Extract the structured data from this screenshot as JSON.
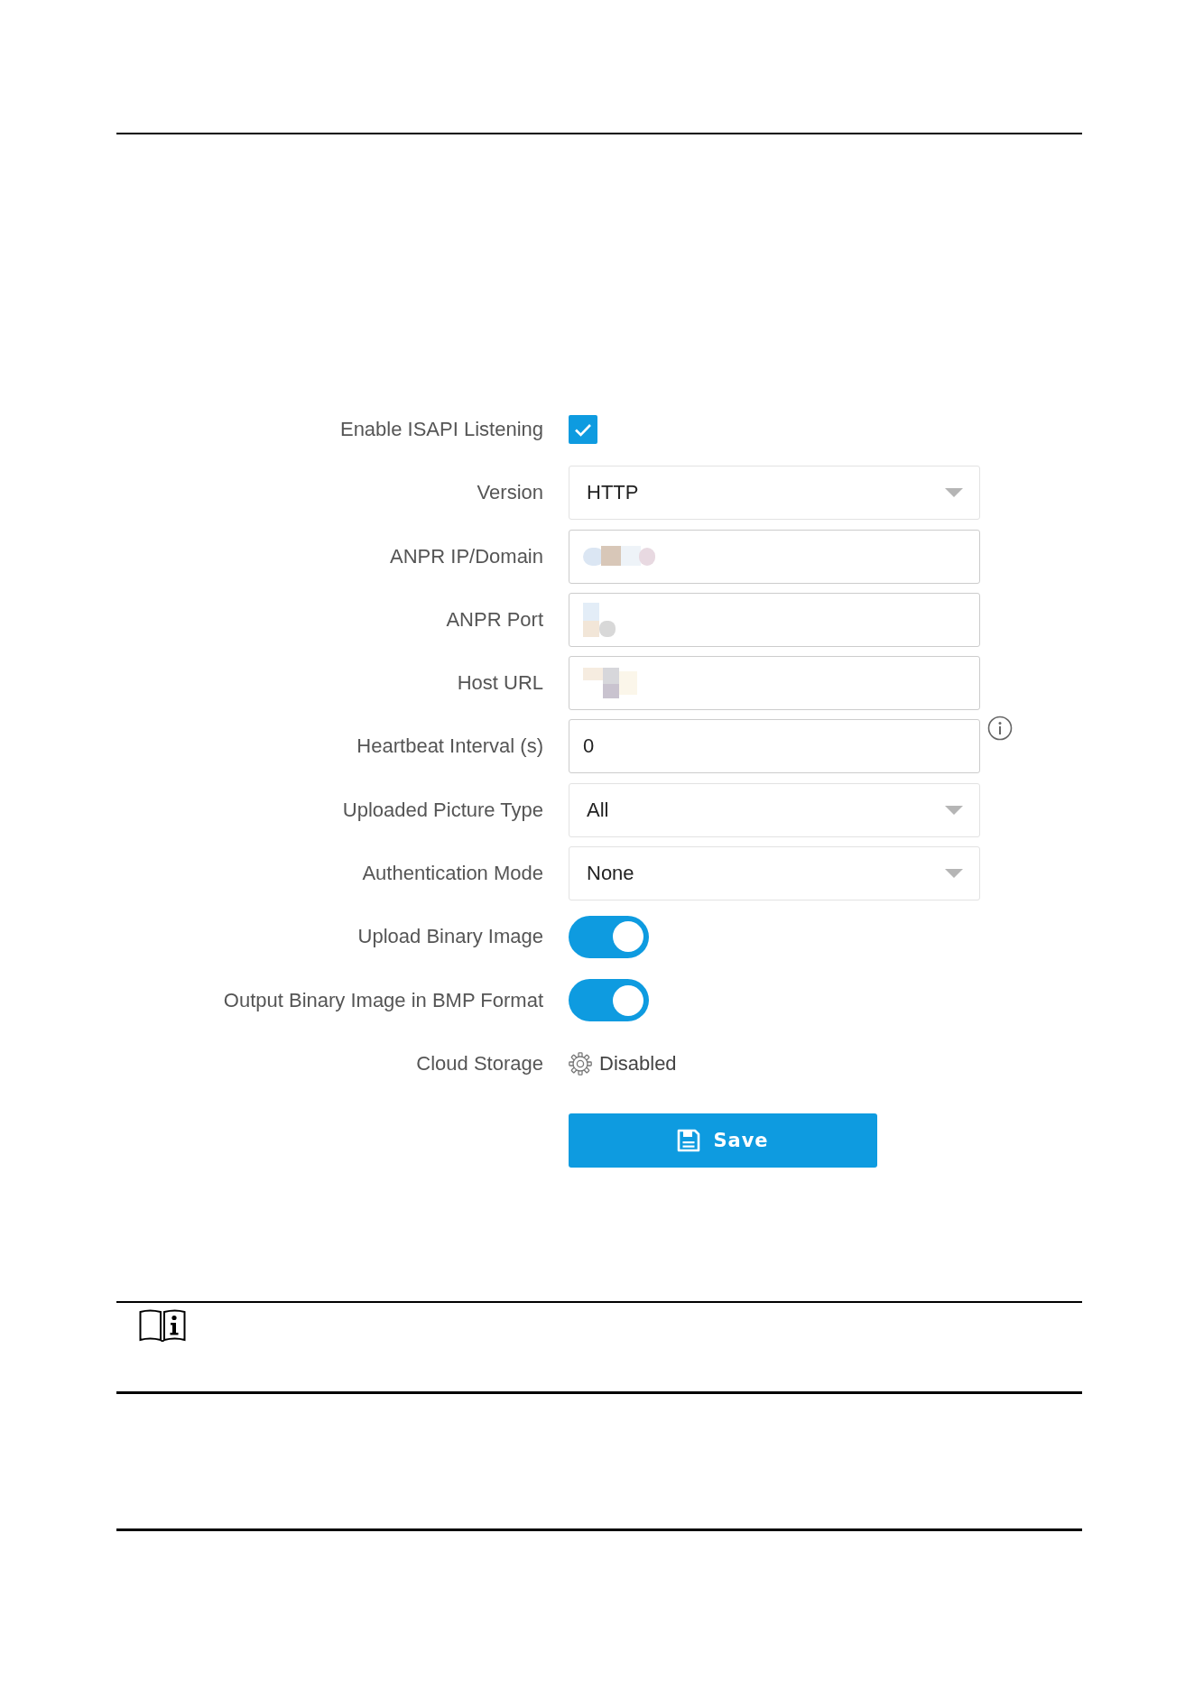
{
  "form": {
    "fields": [
      {
        "kind": "checkbox",
        "label": "Enable ISAPI Listening",
        "checked": true
      },
      {
        "kind": "select",
        "label": "Version",
        "value": "HTTP"
      },
      {
        "kind": "input",
        "label": "ANPR IP/Domain",
        "redacted": true
      },
      {
        "kind": "input",
        "label": "ANPR Port",
        "redacted": true
      },
      {
        "kind": "input",
        "label": "Host URL",
        "redacted": true
      },
      {
        "kind": "input",
        "label": "Heartbeat Interval (s)",
        "value": "0",
        "info": true
      },
      {
        "kind": "select",
        "label": "Uploaded Picture Type",
        "value": "All"
      },
      {
        "kind": "select",
        "label": "Authentication Mode",
        "value": "None"
      },
      {
        "kind": "toggle",
        "label": "Upload Binary Image",
        "on": true
      },
      {
        "kind": "toggle",
        "label": "Output Binary Image in BMP Format",
        "on": true
      },
      {
        "kind": "status",
        "label": "Cloud Storage",
        "value": "Disabled"
      }
    ],
    "save_button": {
      "label": "Save"
    }
  }
}
